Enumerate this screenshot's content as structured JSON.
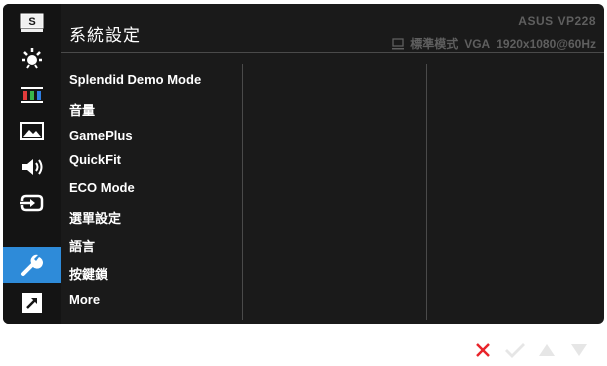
{
  "header": {
    "title": "系統設定",
    "model": "ASUS  VP228",
    "mode": "標準模式",
    "input": "VGA",
    "resolution": "1920x1080@60Hz"
  },
  "sidebar": {
    "items": [
      {
        "name": "splendid-icon",
        "label": "S"
      },
      {
        "name": "blue-light-filter-icon"
      },
      {
        "name": "color-icon"
      },
      {
        "name": "image-icon"
      },
      {
        "name": "sound-icon"
      },
      {
        "name": "input-select-icon"
      },
      {
        "name": "system-setup-icon",
        "active": true
      },
      {
        "name": "shortcut-icon"
      }
    ]
  },
  "menu": {
    "items": [
      {
        "label": "Splendid Demo Mode"
      },
      {
        "label": "音量"
      },
      {
        "label": "GamePlus"
      },
      {
        "label": "QuickFit"
      },
      {
        "label": "ECO Mode"
      },
      {
        "label": "選單設定"
      },
      {
        "label": "語言"
      },
      {
        "label": "按鍵鎖"
      },
      {
        "label": "More"
      }
    ]
  },
  "nav": {
    "buttons": [
      "close-icon",
      "check-icon",
      "up-arrow-icon",
      "down-arrow-icon"
    ],
    "colors": {
      "close": "#e8232a",
      "other": "#e6e6e6"
    }
  },
  "colors": {
    "panel": "#1a1a1a",
    "sidebar": "#141414",
    "accent": "#2e8bd9",
    "status_text": "#5f5f5f"
  }
}
